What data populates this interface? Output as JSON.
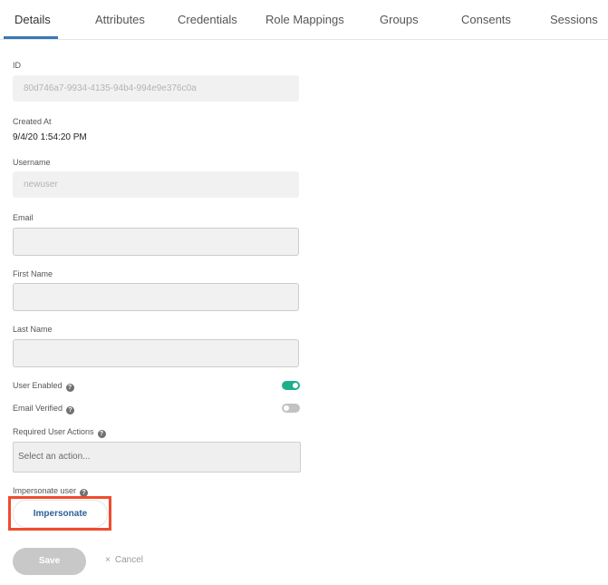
{
  "tabs": [
    {
      "label": "Details",
      "active": true
    },
    {
      "label": "Attributes"
    },
    {
      "label": "Credentials"
    },
    {
      "label": "Role Mappings"
    },
    {
      "label": "Groups"
    },
    {
      "label": "Consents"
    },
    {
      "label": "Sessions"
    }
  ],
  "form": {
    "id": {
      "label": "ID",
      "value": "80d746a7-9934-4135-94b4-994e9e376c0a"
    },
    "created_at": {
      "label": "Created At",
      "value": "9/4/20 1:54:20 PM"
    },
    "username": {
      "label": "Username",
      "value": "newuser"
    },
    "email": {
      "label": "Email",
      "value": ""
    },
    "first_name": {
      "label": "First Name",
      "value": ""
    },
    "last_name": {
      "label": "Last Name",
      "value": ""
    },
    "user_enabled": {
      "label": "User Enabled",
      "on": true
    },
    "email_verified": {
      "label": "Email Verified",
      "on": false
    },
    "required_actions": {
      "label": "Required User Actions",
      "placeholder": "Select an action..."
    },
    "impersonate": {
      "label": "Impersonate user",
      "button_label": "Impersonate"
    }
  },
  "actions": {
    "save_label": "Save",
    "cancel_label": "Cancel",
    "cancel_icon": "×"
  },
  "colors": {
    "toggle_on": "#1fae8c",
    "toggle_off": "#c2c2c2",
    "accent": "#3a78b5",
    "highlight": "#f04b2e"
  },
  "icons": {
    "help": "?"
  }
}
